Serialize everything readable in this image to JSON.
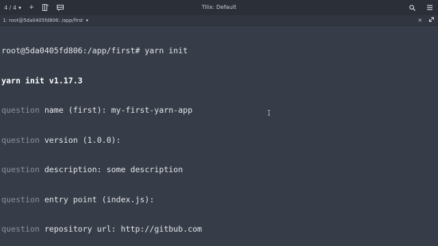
{
  "header": {
    "session_count": "4 / 4",
    "title": "Tilix: Default"
  },
  "tabbar": {
    "title": "1: root@5da0405fd806: /app/first"
  },
  "terminal": {
    "lines": [
      {
        "text": "root@5da0405fd806:/app/first# yarn init"
      },
      {
        "text": "yarn init v1.17.3"
      },
      {
        "prefix": "question",
        "text": " name (first): my-first-yarn-app"
      },
      {
        "prefix": "question",
        "text": " version (1.0.0):"
      },
      {
        "prefix": "question",
        "text": " description: some description"
      },
      {
        "prefix": "question",
        "text": " entry point (index.js):"
      },
      {
        "prefix": "question",
        "text": " repository url: http://gitbub.com"
      }
    ]
  },
  "icons": {
    "dropdown": "chevron-down-icon",
    "add": "plus-icon",
    "split": "split-vertical-icon",
    "split_h": "split-horizontal-icon",
    "search": "search-icon",
    "menu": "hamburger-menu-icon",
    "close": "close-icon",
    "maximize": "maximize-icon"
  }
}
